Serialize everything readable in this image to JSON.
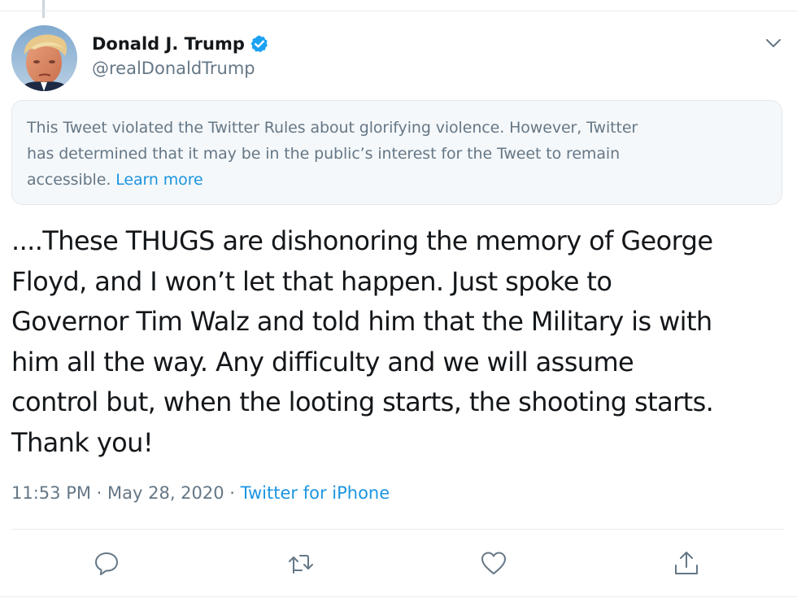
{
  "author": {
    "name": "Donald J. Trump",
    "handle": "@realDonaldTrump",
    "verified": true,
    "avatar_icon": "profile-photo"
  },
  "notice": {
    "lines": [
      "This Tweet violated the Twitter Rules about glorifying violence. However, Twitter",
      "has determined that it may be in the public’s interest for the Tweet to remain"
    ],
    "last_line_prefix": "accessible. ",
    "link_text": "Learn more"
  },
  "tweet": {
    "lines": [
      "....These THUGS are dishonoring the memory of George",
      "Floyd, and I won’t let that happen. Just spoke to",
      "Governor Tim Walz and told him that the Military is with",
      "him all the way. Any difficulty and we will assume",
      "control but, when the looting starts, the shooting starts.",
      "Thank you!"
    ]
  },
  "meta": {
    "time": "11:53 PM",
    "separator": " · ",
    "date": "May 28, 2020",
    "source": "Twitter for iPhone"
  },
  "actions": {
    "icons": [
      "reply-icon",
      "retweet-icon",
      "like-icon",
      "share-icon"
    ]
  },
  "colors": {
    "text": "#14171a",
    "secondary": "#657786",
    "link": "#1b95e0",
    "verified": "#1da1f2",
    "notice_bg": "#f5f8fa",
    "divider": "#e6ecf0"
  }
}
